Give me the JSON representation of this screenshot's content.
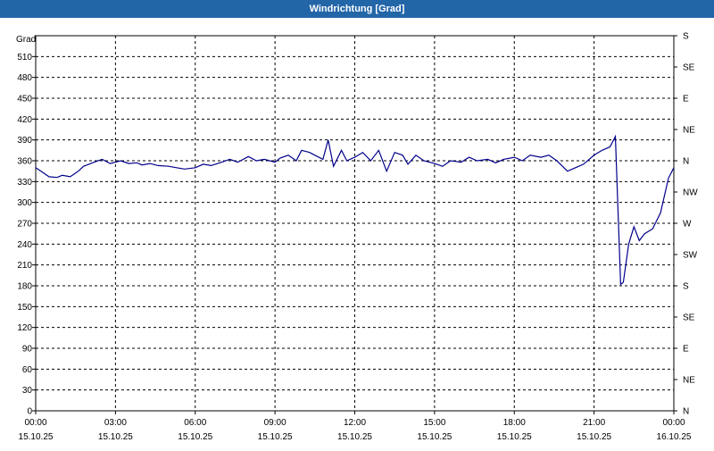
{
  "window": {
    "title": "Windrichtung [Grad]"
  },
  "colors": {
    "titlebar": "#2366a8",
    "series": "#00008b",
    "grid": "#000000"
  },
  "chart_data": {
    "type": "line",
    "title": "Windrichtung [Grad]",
    "ylabel": "Grad",
    "ylim": [
      0,
      540
    ],
    "yticks": [
      0,
      30,
      60,
      90,
      120,
      150,
      180,
      210,
      240,
      270,
      300,
      330,
      360,
      390,
      420,
      450,
      480,
      510
    ],
    "right_axis_labels": [
      {
        "value": 0,
        "label": "N"
      },
      {
        "value": 45,
        "label": "NE"
      },
      {
        "value": 90,
        "label": "E"
      },
      {
        "value": 135,
        "label": "SE"
      },
      {
        "value": 180,
        "label": "S"
      },
      {
        "value": 225,
        "label": "SW"
      },
      {
        "value": 270,
        "label": "W"
      },
      {
        "value": 315,
        "label": "NW"
      },
      {
        "value": 360,
        "label": "N"
      },
      {
        "value": 405,
        "label": "NE"
      },
      {
        "value": 450,
        "label": "E"
      },
      {
        "value": 495,
        "label": "SE"
      },
      {
        "value": 540,
        "label": "S"
      }
    ],
    "xlim_hours": [
      0,
      24
    ],
    "xticks": [
      {
        "hour": 0,
        "time": "00:00",
        "date": "15.10.25"
      },
      {
        "hour": 3,
        "time": "03:00",
        "date": "15.10.25"
      },
      {
        "hour": 6,
        "time": "06:00",
        "date": "15.10.25"
      },
      {
        "hour": 9,
        "time": "09:00",
        "date": "15.10.25"
      },
      {
        "hour": 12,
        "time": "12:00",
        "date": "15.10.25"
      },
      {
        "hour": 15,
        "time": "15:00",
        "date": "15.10.25"
      },
      {
        "hour": 18,
        "time": "18:00",
        "date": "15.10.25"
      },
      {
        "hour": 21,
        "time": "21:00",
        "date": "15.10.25"
      },
      {
        "hour": 24,
        "time": "00:00",
        "date": "16.10.25"
      }
    ],
    "grid": true,
    "series": [
      {
        "x": [
          0,
          0.2,
          0.5,
          0.8,
          1.0,
          1.3,
          1.6,
          1.8,
          2.0,
          2.2,
          2.5,
          2.8,
          3.0,
          3.2,
          3.5,
          3.8,
          4.0,
          4.3,
          4.6,
          5.0,
          5.3,
          5.6,
          6.0,
          6.3,
          6.6,
          7.0,
          7.3,
          7.6,
          8.0,
          8.3,
          8.6,
          9.0,
          9.2,
          9.5,
          9.8,
          10.0,
          10.3,
          10.5,
          10.8,
          11.0,
          11.2,
          11.5,
          11.7,
          12.0,
          12.3,
          12.6,
          12.9,
          13.2,
          13.5,
          13.8,
          14.0,
          14.3,
          14.6,
          15.0,
          15.3,
          15.6,
          16.0,
          16.3,
          16.6,
          17.0,
          17.3,
          17.6,
          18.0,
          18.3,
          18.6,
          19.0,
          19.3,
          19.6,
          20.0,
          20.3,
          20.6,
          21.0,
          21.3,
          21.6,
          21.8,
          21.9,
          22.0,
          22.1,
          22.3,
          22.5,
          22.7,
          22.9,
          23.2,
          23.5,
          23.8,
          24.0
        ],
        "y": [
          350,
          345,
          337,
          336,
          339,
          337,
          345,
          352,
          355,
          358,
          362,
          356,
          358,
          360,
          356,
          357,
          354,
          356,
          353,
          352,
          350,
          348,
          350,
          355,
          353,
          358,
          362,
          358,
          366,
          360,
          362,
          358,
          364,
          368,
          360,
          375,
          372,
          368,
          362,
          390,
          352,
          375,
          360,
          365,
          372,
          360,
          375,
          345,
          372,
          368,
          355,
          368,
          360,
          356,
          352,
          360,
          358,
          365,
          360,
          362,
          357,
          362,
          365,
          360,
          368,
          365,
          368,
          360,
          345,
          350,
          355,
          368,
          375,
          380,
          395,
          290,
          182,
          185,
          240,
          265,
          245,
          255,
          262,
          285,
          335,
          350
        ]
      }
    ]
  }
}
